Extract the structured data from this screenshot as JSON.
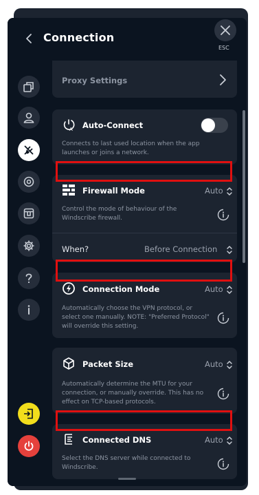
{
  "header": {
    "title": "Connection",
    "esc_label": "ESC"
  },
  "sidebar": {
    "items": [
      {
        "icon": "network-icon"
      },
      {
        "icon": "user-icon"
      },
      {
        "icon": "plug-icon",
        "active": true
      },
      {
        "icon": "robert-icon"
      },
      {
        "icon": "wallpaper-icon"
      },
      {
        "icon": "gear-icon"
      },
      {
        "icon": "question-icon"
      },
      {
        "icon": "info-icon"
      }
    ],
    "exit_icon": "exit-icon",
    "power_icon": "power-icon"
  },
  "settings": {
    "proxy": {
      "label": "Proxy Settings"
    },
    "auto_connect": {
      "label": "Auto-Connect",
      "description": "Connects to last used location when the app launches or joins a network.",
      "enabled": false
    },
    "firewall": {
      "label": "Firewall Mode",
      "value": "Auto",
      "description": "Control the mode of behaviour of the Windscribe firewall."
    },
    "when": {
      "label": "When?",
      "value": "Before Connection"
    },
    "connection_mode": {
      "label": "Connection Mode",
      "value": "Auto",
      "description": "Automatically choose the VPN protocol, or select one manually. NOTE: \"Preferred Protocol\" will override this setting."
    },
    "packet_size": {
      "label": "Packet Size",
      "value": "Auto",
      "description": "Automatically determine the MTU for your connection, or manually override.  This has no effect on TCP-based protocols."
    },
    "connected_dns": {
      "label": "Connected DNS",
      "value": "Auto",
      "description": "Select the DNS server while connected to Windscribe."
    }
  },
  "colors": {
    "highlight": "#e01010",
    "exit_button": "#f2dd1c",
    "power_button": "#e5413c"
  }
}
